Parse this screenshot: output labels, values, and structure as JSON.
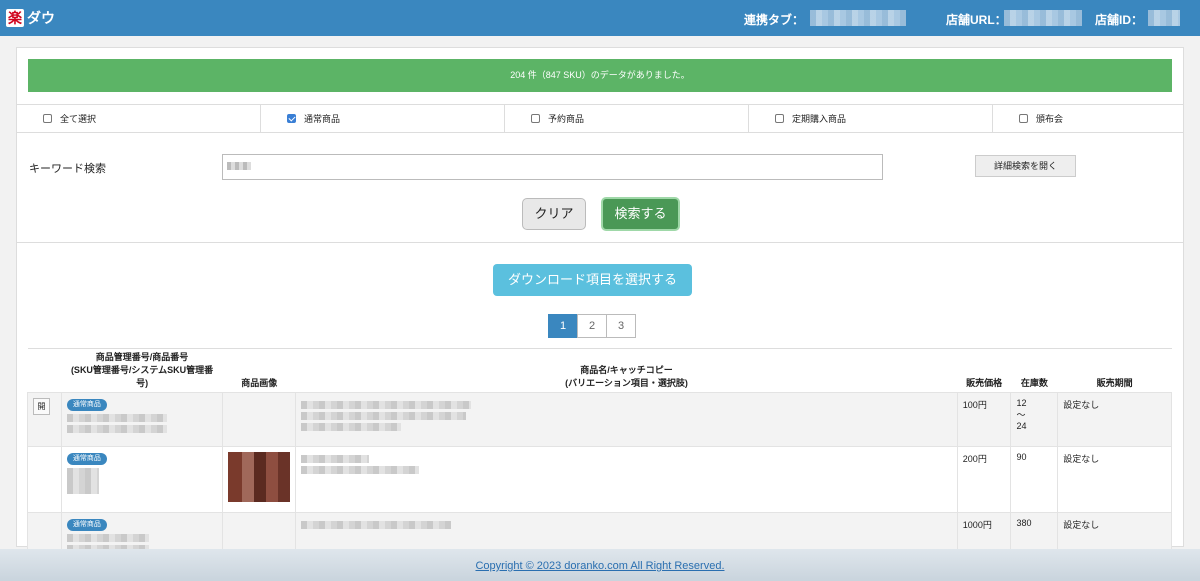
{
  "header": {
    "brand": "ダウ",
    "brand_icon": "楽",
    "link_tab_label": "連携タブ：",
    "store_url_label": "店舗URL：",
    "store_id_label": "店舗ID："
  },
  "alert": {
    "message": "204 件（847 SKU）のデータがありました。"
  },
  "filters": [
    {
      "label": "全て選択",
      "checked": false
    },
    {
      "label": "通常商品",
      "checked": true
    },
    {
      "label": "予約商品",
      "checked": false
    },
    {
      "label": "定期購入商品",
      "checked": false
    },
    {
      "label": "頒布会",
      "checked": false
    }
  ],
  "search": {
    "keyword_label": "キーワード検索",
    "detail_button": "詳細検索を開く",
    "clear_button": "クリア",
    "search_button": "検索する"
  },
  "download_button": "ダウンロード項目を選択する",
  "pagination": {
    "pages": [
      "1",
      "2",
      "3"
    ],
    "active": "1"
  },
  "table": {
    "col_code_line1": "商品管理番号/商品番号",
    "col_code_line2": "(SKU管理番号/システムSKU管理番号)",
    "col_image": "商品画像",
    "col_name_line1": "商品名/キャッチコピー",
    "col_name_line2": "(バリエーション項目・選択肢)",
    "col_price": "販売価格",
    "col_stock": "在庫数",
    "col_period": "販売期間",
    "rows": [
      {
        "open": "開",
        "badge": "通常商品",
        "price": "100円",
        "stock": "12",
        "stock_sep": "〜",
        "stock_max": "24",
        "period": "設定なし"
      },
      {
        "open": "",
        "badge": "通常商品",
        "price": "200円",
        "stock": "90",
        "stock_sep": "",
        "stock_max": "",
        "period": "設定なし"
      },
      {
        "open": "",
        "badge": "通常商品",
        "price": "1000円",
        "stock": "380",
        "stock_sep": "",
        "stock_max": "",
        "period": "設定なし"
      }
    ]
  },
  "footer": {
    "copyright": "Copyright © 2023 doranko.com All Right Reserved."
  },
  "colors": {
    "header": "#3a87bf",
    "alert": "#5cb466",
    "search_button": "#4a9856",
    "download_button": "#5bc0de"
  }
}
